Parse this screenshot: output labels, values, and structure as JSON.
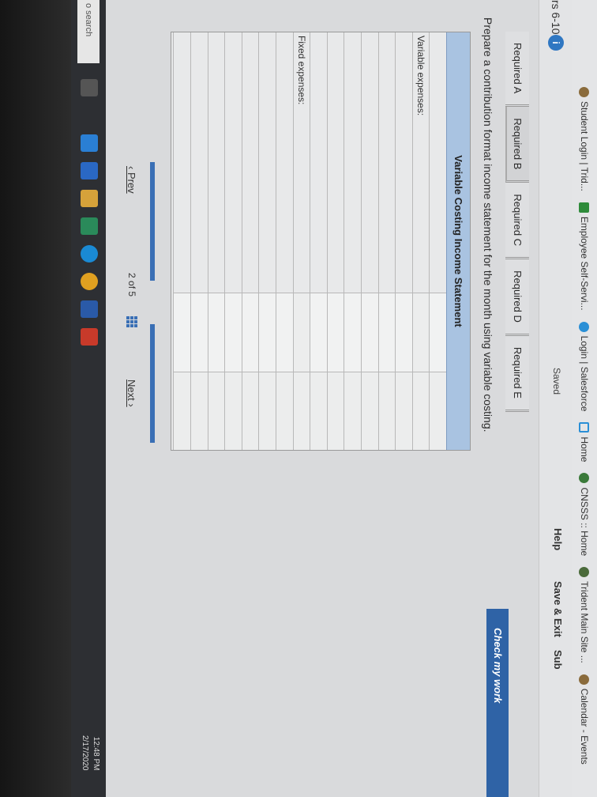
{
  "bookmarks": [
    {
      "label": "Student Login | Trid...",
      "icon": "student-icon"
    },
    {
      "label": "Employee Self-Servi...",
      "icon": "employee-icon"
    },
    {
      "label": "Login | Salesforce",
      "icon": "salesforce-icon"
    },
    {
      "label": "Home",
      "icon": "home-icon"
    },
    {
      "label": "CNSSS :: Home",
      "icon": "cnss-icon"
    },
    {
      "label": "Trident Main Site ...",
      "icon": "trident-icon"
    },
    {
      "label": "Calendar - Events",
      "icon": "calendar-icon"
    }
  ],
  "header": {
    "chapter": "rs 6-10",
    "info": "i",
    "saved": "Saved",
    "help": "Help",
    "save_exit": "Save & Exit",
    "submit": "Sub",
    "check_work": "Check my work"
  },
  "tabs": [
    {
      "label": "Required A"
    },
    {
      "label": "Required B"
    },
    {
      "label": "Required C"
    },
    {
      "label": "Required D"
    },
    {
      "label": "Required E"
    }
  ],
  "instruction": "Prepare a contribution format income statement for the month using variable costing.",
  "statement": {
    "title": "Variable Costing Income Statement",
    "variable_label": "Variable expenses:",
    "fixed_label": "Fixed expenses:"
  },
  "pager": {
    "prev": "Prev",
    "current": "2",
    "of": "of",
    "total": "5",
    "next": "Next"
  },
  "taskbar": {
    "search": "o search",
    "time": "12:48 PM",
    "date": "2/17/2020"
  }
}
